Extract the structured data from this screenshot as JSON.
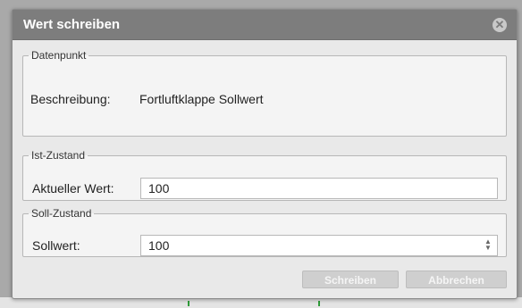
{
  "dialog": {
    "title": "Wert schreiben",
    "close_icon": "close-icon"
  },
  "datenpunkt": {
    "legend": "Datenpunkt",
    "beschreibung_label": "Beschreibung:",
    "beschreibung_value": "Fortluftklappe Sollwert"
  },
  "ist_zustand": {
    "legend": "Ist-Zustand",
    "aktueller_wert_label": "Aktueller Wert:",
    "aktueller_wert_value": "100"
  },
  "soll_zustand": {
    "legend": "Soll-Zustand",
    "sollwert_label": "Sollwert:",
    "sollwert_value": "100"
  },
  "buttons": {
    "schreiben": "Schreiben",
    "abbrechen": "Abbrechen"
  },
  "colors": {
    "titlebar": "#7d7d7d",
    "dialog_bg": "#e9e9e9",
    "button_disabled": "#cfcfcf"
  }
}
